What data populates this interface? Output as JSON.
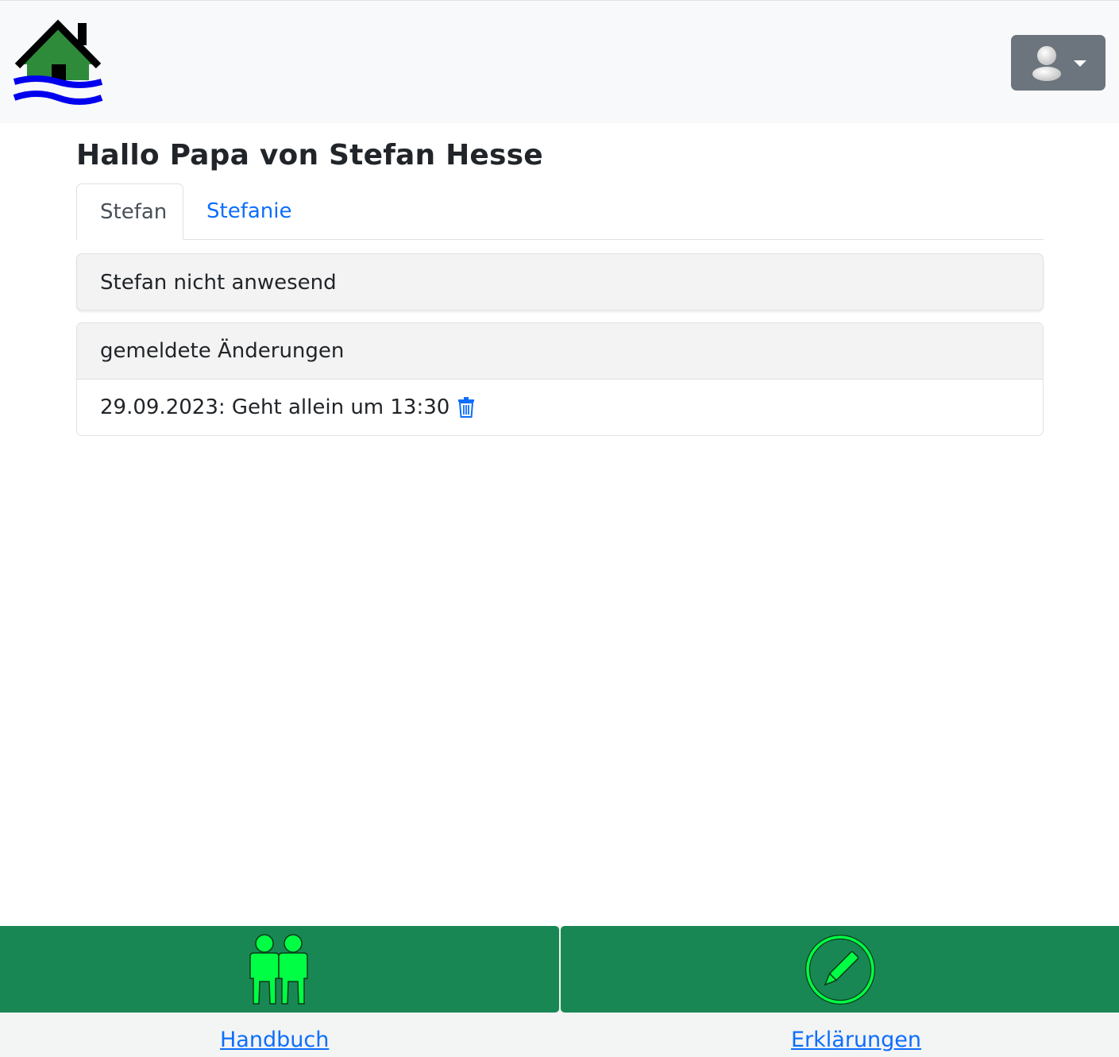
{
  "header": {
    "logo_icon": "house-flood-icon",
    "user_menu_icon": "user-avatar-icon"
  },
  "page": {
    "title": "Hallo Papa von Stefan Hesse"
  },
  "tabs": [
    {
      "label": "Stefan",
      "active": true
    },
    {
      "label": "Stefanie",
      "active": false
    }
  ],
  "status": {
    "text": "Stefan nicht anwesend"
  },
  "changes": {
    "header": "gemeldete Änderungen",
    "items": [
      {
        "text": "29.09.2023: Geht allein um 13:30",
        "action_icon": "trash-icon"
      }
    ]
  },
  "footer": {
    "left": {
      "icon": "people-icon",
      "label": "Handbuch"
    },
    "right": {
      "icon": "pen-circle-icon",
      "label": "Erklärungen"
    }
  },
  "colors": {
    "navbar_bg": "#f8f9fa",
    "user_button": "#6c757d",
    "link": "#0d6efd",
    "footer_button": "#198754",
    "footer_icon": "#00ff44"
  }
}
